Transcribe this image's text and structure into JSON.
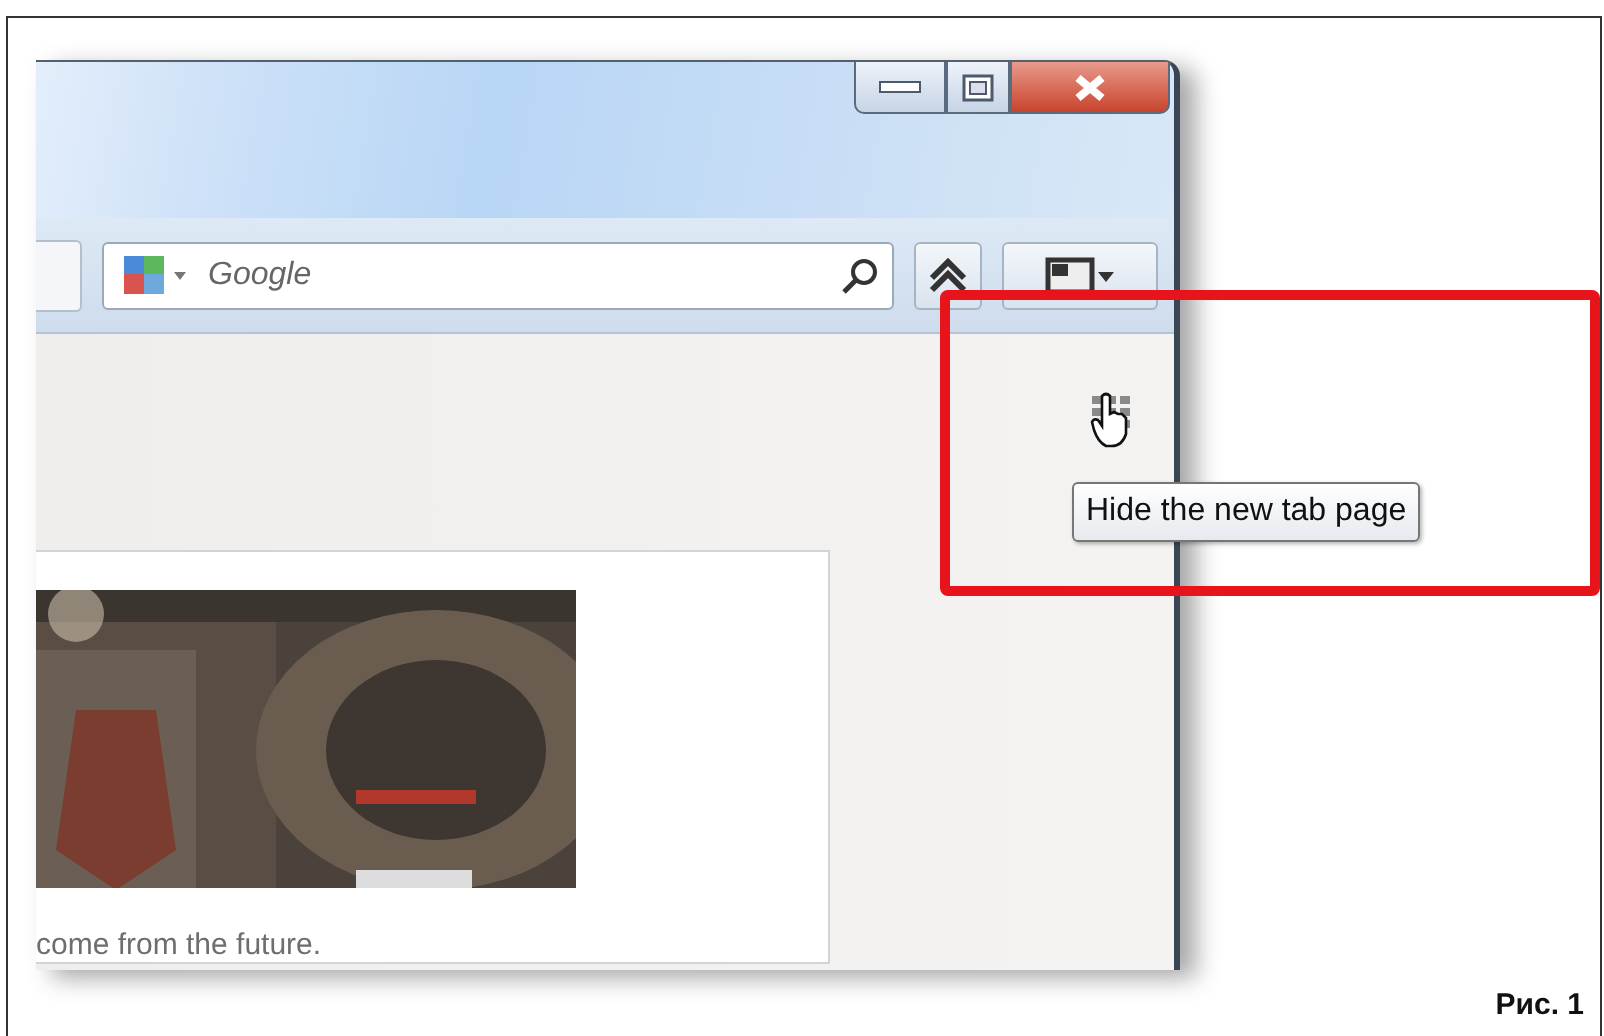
{
  "search": {
    "placeholder": "Google"
  },
  "thumbnails": [
    {
      "kind": "picture",
      "caption": "come from the future."
    }
  ],
  "tooltip": {
    "text": "Hide the new tab page"
  },
  "figure_caption": "Рис. 1"
}
